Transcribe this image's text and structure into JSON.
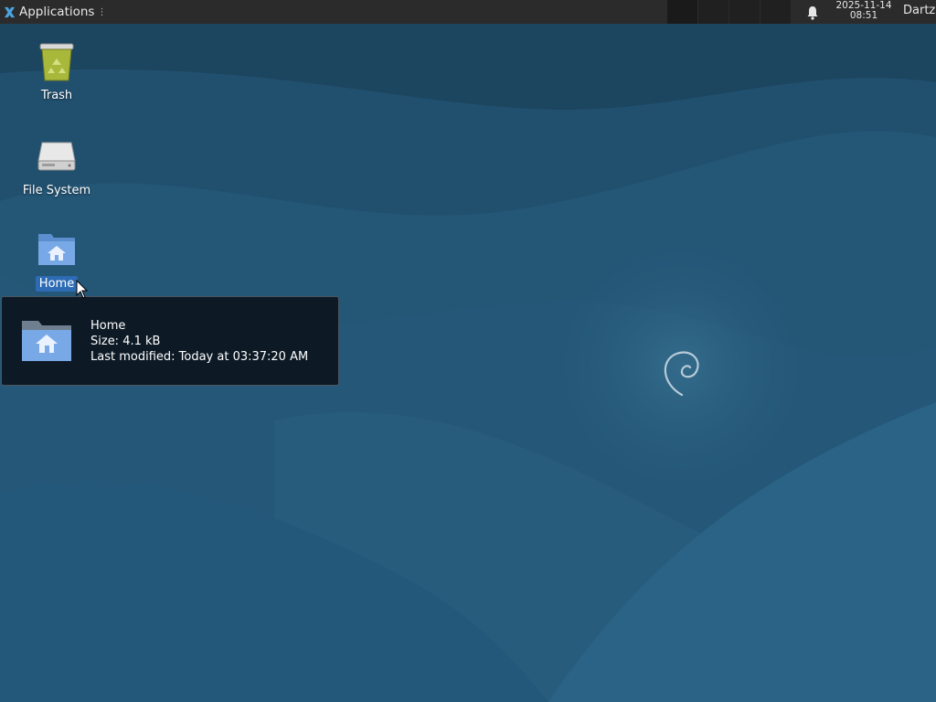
{
  "panel": {
    "app_menu_label": "Applications",
    "app_menu_grip": "⋮",
    "clock_date": "2025-11-14",
    "clock_time": "08:51",
    "user_label": "Dartz",
    "workspace_count": 4
  },
  "desktop": {
    "icons": [
      {
        "label": "Trash",
        "icon": "trash-icon"
      },
      {
        "label": "File System",
        "icon": "drive-icon"
      },
      {
        "label": "Home",
        "icon": "home-folder-icon",
        "selected": true
      }
    ]
  },
  "tooltip": {
    "name": "Home",
    "size": "Size: 4.1 kB",
    "modified": "Last modified: Today at 03:37:20 AM"
  },
  "colors": {
    "wallpaper_base": "#1f4f6e",
    "panel": "#2b2b2b",
    "selection": "#2d6cb5",
    "tooltip_bg": "#0d1a26"
  }
}
